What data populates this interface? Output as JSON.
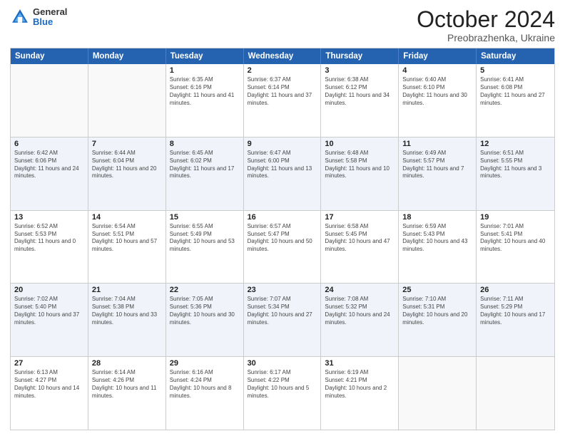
{
  "header": {
    "logo": {
      "line1": "General",
      "line2": "Blue"
    },
    "title": "October 2024",
    "subtitle": "Preobrazhenka, Ukraine"
  },
  "days": [
    "Sunday",
    "Monday",
    "Tuesday",
    "Wednesday",
    "Thursday",
    "Friday",
    "Saturday"
  ],
  "weeks": [
    [
      {
        "day": "",
        "sunrise": "",
        "sunset": "",
        "daylight": ""
      },
      {
        "day": "",
        "sunrise": "",
        "sunset": "",
        "daylight": ""
      },
      {
        "day": "1",
        "sunrise": "Sunrise: 6:35 AM",
        "sunset": "Sunset: 6:16 PM",
        "daylight": "Daylight: 11 hours and 41 minutes."
      },
      {
        "day": "2",
        "sunrise": "Sunrise: 6:37 AM",
        "sunset": "Sunset: 6:14 PM",
        "daylight": "Daylight: 11 hours and 37 minutes."
      },
      {
        "day": "3",
        "sunrise": "Sunrise: 6:38 AM",
        "sunset": "Sunset: 6:12 PM",
        "daylight": "Daylight: 11 hours and 34 minutes."
      },
      {
        "day": "4",
        "sunrise": "Sunrise: 6:40 AM",
        "sunset": "Sunset: 6:10 PM",
        "daylight": "Daylight: 11 hours and 30 minutes."
      },
      {
        "day": "5",
        "sunrise": "Sunrise: 6:41 AM",
        "sunset": "Sunset: 6:08 PM",
        "daylight": "Daylight: 11 hours and 27 minutes."
      }
    ],
    [
      {
        "day": "6",
        "sunrise": "Sunrise: 6:42 AM",
        "sunset": "Sunset: 6:06 PM",
        "daylight": "Daylight: 11 hours and 24 minutes."
      },
      {
        "day": "7",
        "sunrise": "Sunrise: 6:44 AM",
        "sunset": "Sunset: 6:04 PM",
        "daylight": "Daylight: 11 hours and 20 minutes."
      },
      {
        "day": "8",
        "sunrise": "Sunrise: 6:45 AM",
        "sunset": "Sunset: 6:02 PM",
        "daylight": "Daylight: 11 hours and 17 minutes."
      },
      {
        "day": "9",
        "sunrise": "Sunrise: 6:47 AM",
        "sunset": "Sunset: 6:00 PM",
        "daylight": "Daylight: 11 hours and 13 minutes."
      },
      {
        "day": "10",
        "sunrise": "Sunrise: 6:48 AM",
        "sunset": "Sunset: 5:58 PM",
        "daylight": "Daylight: 11 hours and 10 minutes."
      },
      {
        "day": "11",
        "sunrise": "Sunrise: 6:49 AM",
        "sunset": "Sunset: 5:57 PM",
        "daylight": "Daylight: 11 hours and 7 minutes."
      },
      {
        "day": "12",
        "sunrise": "Sunrise: 6:51 AM",
        "sunset": "Sunset: 5:55 PM",
        "daylight": "Daylight: 11 hours and 3 minutes."
      }
    ],
    [
      {
        "day": "13",
        "sunrise": "Sunrise: 6:52 AM",
        "sunset": "Sunset: 5:53 PM",
        "daylight": "Daylight: 11 hours and 0 minutes."
      },
      {
        "day": "14",
        "sunrise": "Sunrise: 6:54 AM",
        "sunset": "Sunset: 5:51 PM",
        "daylight": "Daylight: 10 hours and 57 minutes."
      },
      {
        "day": "15",
        "sunrise": "Sunrise: 6:55 AM",
        "sunset": "Sunset: 5:49 PM",
        "daylight": "Daylight: 10 hours and 53 minutes."
      },
      {
        "day": "16",
        "sunrise": "Sunrise: 6:57 AM",
        "sunset": "Sunset: 5:47 PM",
        "daylight": "Daylight: 10 hours and 50 minutes."
      },
      {
        "day": "17",
        "sunrise": "Sunrise: 6:58 AM",
        "sunset": "Sunset: 5:45 PM",
        "daylight": "Daylight: 10 hours and 47 minutes."
      },
      {
        "day": "18",
        "sunrise": "Sunrise: 6:59 AM",
        "sunset": "Sunset: 5:43 PM",
        "daylight": "Daylight: 10 hours and 43 minutes."
      },
      {
        "day": "19",
        "sunrise": "Sunrise: 7:01 AM",
        "sunset": "Sunset: 5:41 PM",
        "daylight": "Daylight: 10 hours and 40 minutes."
      }
    ],
    [
      {
        "day": "20",
        "sunrise": "Sunrise: 7:02 AM",
        "sunset": "Sunset: 5:40 PM",
        "daylight": "Daylight: 10 hours and 37 minutes."
      },
      {
        "day": "21",
        "sunrise": "Sunrise: 7:04 AM",
        "sunset": "Sunset: 5:38 PM",
        "daylight": "Daylight: 10 hours and 33 minutes."
      },
      {
        "day": "22",
        "sunrise": "Sunrise: 7:05 AM",
        "sunset": "Sunset: 5:36 PM",
        "daylight": "Daylight: 10 hours and 30 minutes."
      },
      {
        "day": "23",
        "sunrise": "Sunrise: 7:07 AM",
        "sunset": "Sunset: 5:34 PM",
        "daylight": "Daylight: 10 hours and 27 minutes."
      },
      {
        "day": "24",
        "sunrise": "Sunrise: 7:08 AM",
        "sunset": "Sunset: 5:32 PM",
        "daylight": "Daylight: 10 hours and 24 minutes."
      },
      {
        "day": "25",
        "sunrise": "Sunrise: 7:10 AM",
        "sunset": "Sunset: 5:31 PM",
        "daylight": "Daylight: 10 hours and 20 minutes."
      },
      {
        "day": "26",
        "sunrise": "Sunrise: 7:11 AM",
        "sunset": "Sunset: 5:29 PM",
        "daylight": "Daylight: 10 hours and 17 minutes."
      }
    ],
    [
      {
        "day": "27",
        "sunrise": "Sunrise: 6:13 AM",
        "sunset": "Sunset: 4:27 PM",
        "daylight": "Daylight: 10 hours and 14 minutes."
      },
      {
        "day": "28",
        "sunrise": "Sunrise: 6:14 AM",
        "sunset": "Sunset: 4:26 PM",
        "daylight": "Daylight: 10 hours and 11 minutes."
      },
      {
        "day": "29",
        "sunrise": "Sunrise: 6:16 AM",
        "sunset": "Sunset: 4:24 PM",
        "daylight": "Daylight: 10 hours and 8 minutes."
      },
      {
        "day": "30",
        "sunrise": "Sunrise: 6:17 AM",
        "sunset": "Sunset: 4:22 PM",
        "daylight": "Daylight: 10 hours and 5 minutes."
      },
      {
        "day": "31",
        "sunrise": "Sunrise: 6:19 AM",
        "sunset": "Sunset: 4:21 PM",
        "daylight": "Daylight: 10 hours and 2 minutes."
      },
      {
        "day": "",
        "sunrise": "",
        "sunset": "",
        "daylight": ""
      },
      {
        "day": "",
        "sunrise": "",
        "sunset": "",
        "daylight": ""
      }
    ]
  ]
}
